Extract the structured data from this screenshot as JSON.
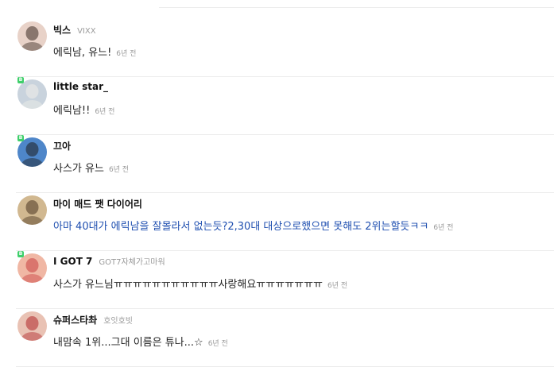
{
  "comments": [
    {
      "nick": "빅스",
      "sub": "VIXX",
      "text": "에릭남, 유느!",
      "time": "6년 전",
      "badge": "",
      "avatar_bg": "#e8d2c8",
      "avatar_fg": "#3a2a22",
      "blue": false
    },
    {
      "nick": "little star_",
      "sub": "",
      "text": "에릭남!!",
      "time": "6년 전",
      "badge": "B",
      "avatar_bg": "#c9d3dd",
      "avatar_fg": "#f0efe9",
      "blue": false
    },
    {
      "nick": "끄아",
      "sub": "",
      "text": "사스가 유느",
      "time": "6년 전",
      "badge": "B",
      "avatar_bg": "#4e86c9",
      "avatar_fg": "#1d1d1d",
      "blue": false
    },
    {
      "nick": "마이 매드 팻 다이어리",
      "sub": "",
      "text": "아마 40대가 에릭남을 잘몰라서 없는듯?2,30대 대상으로했으면 못해도 2위는할듯ㅋㅋ",
      "time": "6년 전",
      "badge": "",
      "avatar_bg": "#d1b890",
      "avatar_fg": "#4a3520",
      "blue": true
    },
    {
      "nick": "I GOT 7",
      "sub": "GOT7자체가고마워",
      "text": "사스가 유느님ㅠㅠㅠㅠㅠㅠㅠㅠㅠㅠㅠ사랑해요ㅠㅠㅠㅠㅠㅠㅠ",
      "time": "6년 전",
      "badge": "B",
      "avatar_bg": "#f0b7a4",
      "avatar_fg": "#c94040",
      "blue": false
    },
    {
      "nick": "슈퍼스타촤",
      "sub": "호잇호빗",
      "text": "내맘속 1위...그대 이름은 튜나...☆",
      "time": "6년 전",
      "badge": "",
      "avatar_bg": "#e9c2b4",
      "avatar_fg": "#b0282a",
      "blue": false
    }
  ]
}
